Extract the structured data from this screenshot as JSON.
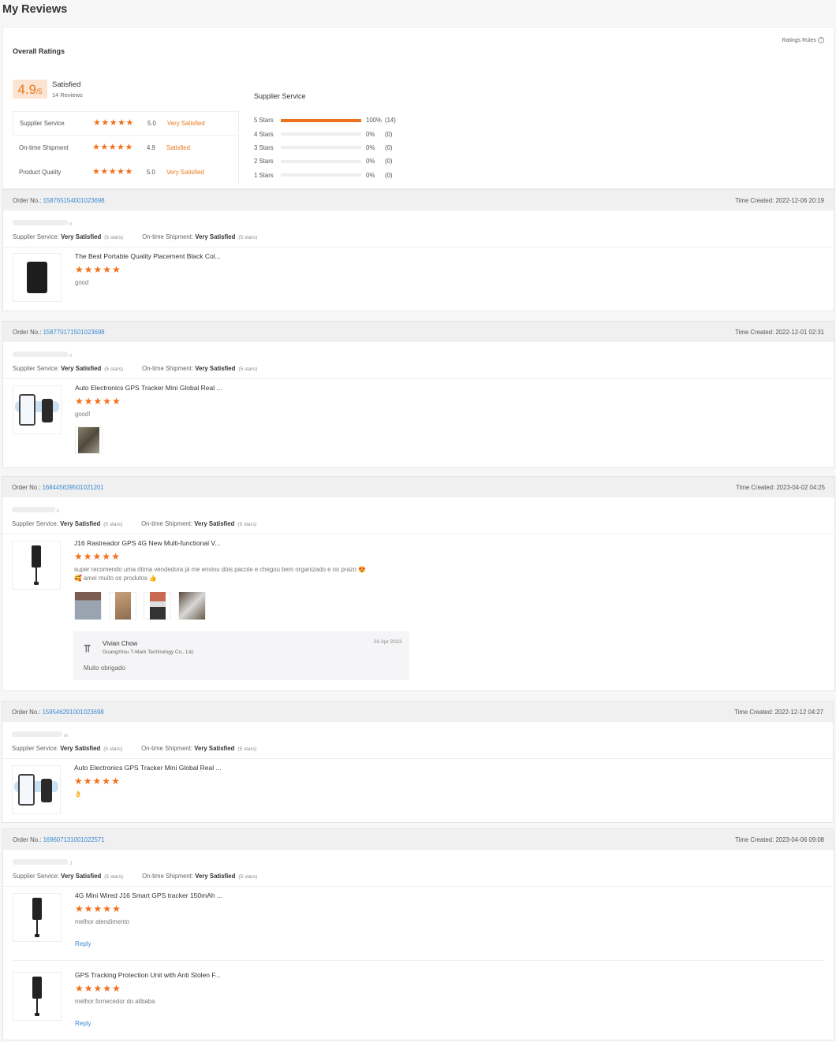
{
  "page_title": "My Reviews",
  "summary": {
    "overall_label": "Overall Ratings",
    "ratings_rules": "Ratings Rules",
    "score": "4.9",
    "score_max": "/5",
    "score_word": "Satisfied",
    "review_count": "14 Reviews",
    "categories": [
      {
        "name": "Supplier Service",
        "stars": 5,
        "value": "5.0",
        "word": "Very Satisfied"
      },
      {
        "name": "On-time Shipment",
        "stars": 5,
        "value": "4.9",
        "word": "Satisfied"
      },
      {
        "name": "Product Quality",
        "stars": 5,
        "value": "5.0",
        "word": "Very Satisfied"
      }
    ],
    "distribution": {
      "title": "Supplier Service",
      "rows": [
        {
          "label": "5 Stars",
          "percent": 100,
          "percent_text": "100%",
          "count": "(14)"
        },
        {
          "label": "4 Stars",
          "percent": 0,
          "percent_text": "0%",
          "count": "(0)"
        },
        {
          "label": "3 Stars",
          "percent": 0,
          "percent_text": "0%",
          "count": "(0)"
        },
        {
          "label": "2 Stars",
          "percent": 0,
          "percent_text": "0%",
          "count": "(0)"
        },
        {
          "label": "1 Stars",
          "percent": 0,
          "percent_text": "0%",
          "count": "(0)"
        }
      ]
    }
  },
  "labels": {
    "order_no": "Order No.:",
    "time_created": "Time Created:",
    "supplier_service": "Supplier Service:",
    "ontime_shipment": "On-time Shipment:",
    "very_satisfied": "Very Satisfied",
    "five_stars": "(5 stars)",
    "reply": "Reply"
  },
  "accent_color": "#f0711d",
  "link_color": "#3a8ad0",
  "orders": [
    {
      "order_no": "158765154001023698",
      "time_created": "2022-12-06 20:19",
      "reviewer_suffix": "n",
      "products": [
        {
          "title": "The Best Portable Quality Placement Black Col...",
          "stars": 5,
          "text": "good"
        }
      ]
    },
    {
      "order_no": "158770171501023698",
      "time_created": "2022-12-01 02:31",
      "reviewer_suffix": "n",
      "products": [
        {
          "title": "Auto Electronics GPS Tracker Mini Global Real ...",
          "stars": 5,
          "text": "good!"
        }
      ]
    },
    {
      "order_no": "168445639501021201",
      "time_created": "2023-04-02 04:25",
      "reviewer_suffix": "il",
      "products": [
        {
          "title": "J16 Rastreador GPS 4G New Multi-functional V...",
          "stars": 5,
          "text_line1": "super recomendo uma ótima vendedora já me enviou dóis pacote e chegou bem organizado e no prazo 😍",
          "text_line2": "🥰 amei muito os produtos 👍",
          "seller_reply": {
            "name": "Vivian Chow",
            "company": "Guangzhou T-Mark Technology Co., Ltd.",
            "date": "03 Apr 2023",
            "text": "Muito obrigado"
          }
        }
      ]
    },
    {
      "order_no": "159546291001023698",
      "time_created": "2022-12-12 04:27",
      "reviewer_suffix": "m",
      "products": [
        {
          "title": "Auto Electronics GPS Tracker Mini Global Real ...",
          "stars": 5,
          "text": "👌"
        }
      ]
    },
    {
      "order_no": "169607131001022571",
      "time_created": "2023-04-06 09:08",
      "reviewer_suffix": "J",
      "products": [
        {
          "title": "4G Mini Wired J16 Smart GPS tracker 150mAh ...",
          "stars": 5,
          "text": "melhor atendimento"
        },
        {
          "title": "GPS Tracking Protection Unit with Anti Stolen F...",
          "stars": 5,
          "text": "melhor fornecedor do alibaba"
        }
      ]
    }
  ]
}
